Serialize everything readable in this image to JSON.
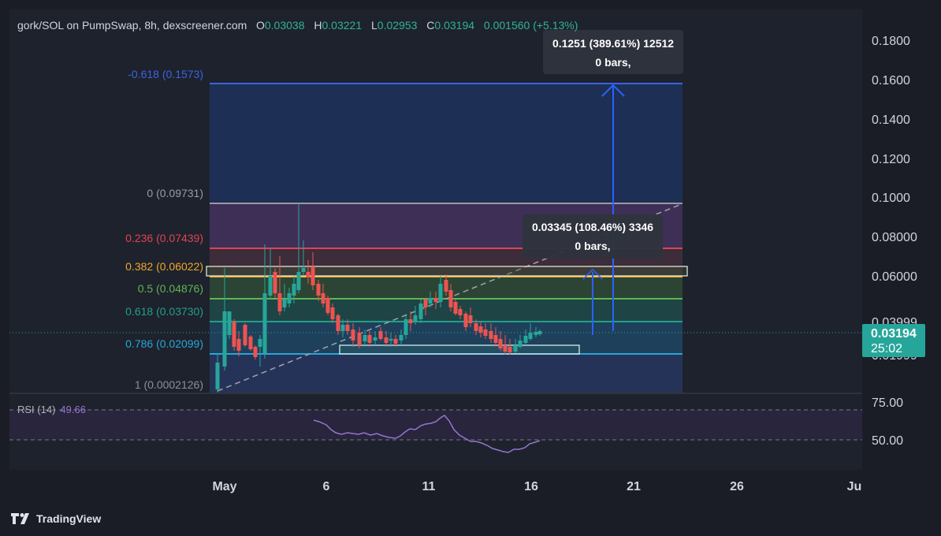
{
  "header": {
    "symbol": "gork/SOL on PumpSwap, 8h, dexscreener.com",
    "open_label": "O",
    "open": "0.03038",
    "high_label": "H",
    "high": "0.03221",
    "low_label": "L",
    "low": "0.02953",
    "close_label": "C",
    "close": "0.03194",
    "change": "0.001560 (+5.13%)"
  },
  "price_axis": {
    "ticks": [
      "0.1800",
      "0.1600",
      "0.1400",
      "0.1200",
      "0.1000",
      "0.08000",
      "0.06000",
      "0.03999",
      "0.01999"
    ],
    "current_price": "0.03194",
    "countdown": "25:02"
  },
  "rsi": {
    "label": "RSI (14)",
    "value": "49.66",
    "ticks": [
      "75.00",
      "50.00"
    ]
  },
  "time_axis": {
    "labels": [
      "May",
      "6",
      "11",
      "16",
      "21",
      "26",
      "Ju"
    ]
  },
  "fib": {
    "levels": [
      {
        "label": "-0.618 (0.1573)",
        "color": "#3b63e0"
      },
      {
        "label": "0 (0.09731)",
        "color": "#9a9aa5"
      },
      {
        "label": "0.236 (0.07439)",
        "color": "#e04452"
      },
      {
        "label": "0.382 (0.06022)",
        "color": "#f0a62b"
      },
      {
        "label": "0.5 (0.04876)",
        "color": "#5fb650"
      },
      {
        "label": "0.618 (0.03730)",
        "color": "#21a08a"
      },
      {
        "label": "0.786 (0.02099)",
        "color": "#27a6d8"
      },
      {
        "label": "1 (0.0002126)",
        "color": "#8a8fa0"
      }
    ]
  },
  "measures": [
    {
      "line1": "0.1251 (389.61%) 12512",
      "line2": "0 bars,"
    },
    {
      "line1": "0.03345 (108.46%) 3346",
      "line2": "0 bars,"
    }
  ],
  "brand": {
    "name": "TradingView"
  },
  "colors": {
    "up": "#26a69a",
    "down": "#ef5350",
    "rsi": "#9575cd",
    "accent": "#2962ff"
  }
}
